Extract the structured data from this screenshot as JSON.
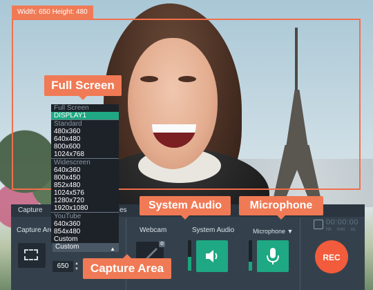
{
  "dimensions_tag": "Width: 650  Height: 480",
  "callouts": {
    "full_screen": "Full Screen",
    "system_audio": "System Audio",
    "microphone": "Microphone",
    "capture_area": "Capture Area"
  },
  "panel": {
    "tabs": [
      "Capture",
      "es"
    ],
    "capture_area_label": "Capture Are",
    "capture_area_value": "Custom",
    "width_value": "650",
    "webcam_label": "Webcam",
    "system_audio_label": "System Audio",
    "microphone_label": "Microphone",
    "microphone_arrow": "▼",
    "timer_digits": "00:00:00",
    "timer_units": "hh mm ss",
    "rec_label": "REC"
  },
  "dropdown": {
    "items": [
      {
        "label": "Full Screen",
        "kind": "header"
      },
      {
        "label": "DISPLAY1",
        "kind": "selected"
      },
      {
        "label": "Standard",
        "kind": "header"
      },
      {
        "label": "480x360",
        "kind": "item"
      },
      {
        "label": "640x480",
        "kind": "item"
      },
      {
        "label": "800x600",
        "kind": "item"
      },
      {
        "label": "1024x768",
        "kind": "item"
      },
      {
        "label": "Widescreen",
        "kind": "header"
      },
      {
        "label": "640x360",
        "kind": "item"
      },
      {
        "label": "800x450",
        "kind": "item"
      },
      {
        "label": "852x480",
        "kind": "item"
      },
      {
        "label": "1024x576",
        "kind": "item"
      },
      {
        "label": "1280x720",
        "kind": "item"
      },
      {
        "label": "1920x1080",
        "kind": "item"
      },
      {
        "label": "YouTube",
        "kind": "header"
      },
      {
        "label": "640x360",
        "kind": "item"
      },
      {
        "label": "854x480",
        "kind": "item"
      },
      {
        "label": "Custom",
        "kind": "item"
      }
    ]
  },
  "colors": {
    "accent_orange": "#f07a55",
    "rec_red": "#f25b3b",
    "toggle_green": "#1ea883",
    "panel_bg": "#34414d"
  },
  "levels": {
    "system_audio_meter": 0.45,
    "microphone_meter": 0.3
  }
}
